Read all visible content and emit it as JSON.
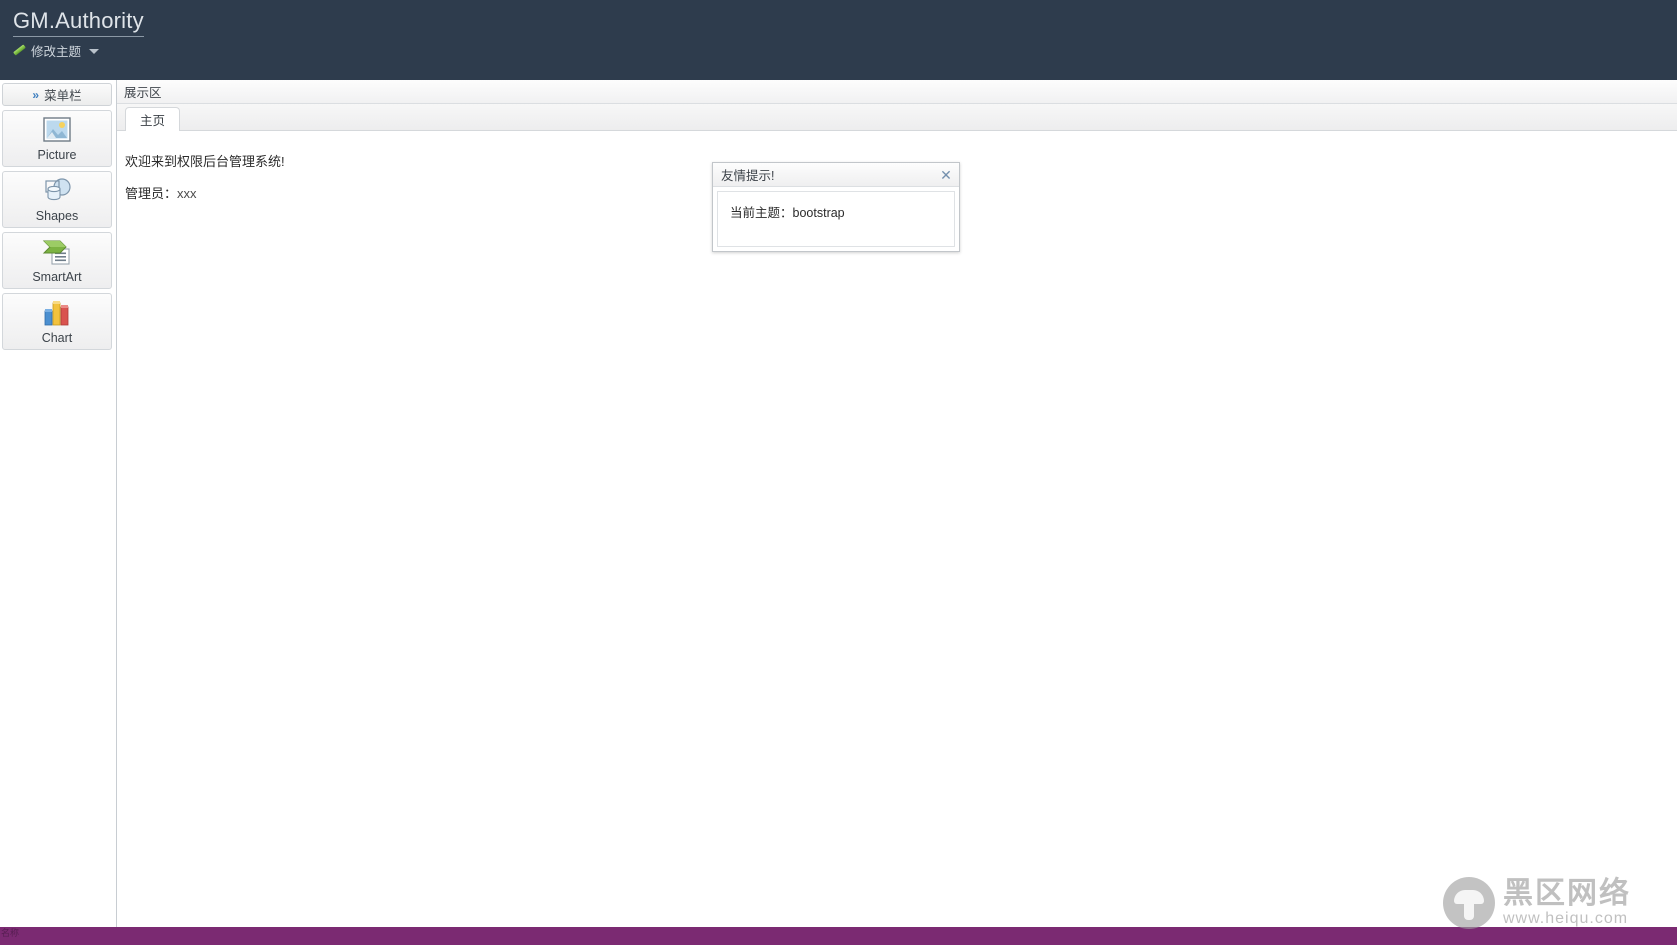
{
  "header": {
    "brand": "GM.Authority",
    "theme_switch": {
      "label": "修改主题",
      "pencil_icon": "pencil-icon",
      "caret_icon": "caret-down-icon"
    }
  },
  "sidebar": {
    "toggle": {
      "label": "菜单栏",
      "icon": "double-chevron-right-icon",
      "chevron": "»"
    },
    "panels": [
      {
        "label": "Picture",
        "icon": "picture-icon"
      },
      {
        "label": "Shapes",
        "icon": "shapes-icon"
      },
      {
        "label": "SmartArt",
        "icon": "smartart-icon"
      },
      {
        "label": "Chart",
        "icon": "chart-icon"
      }
    ]
  },
  "center": {
    "region_title": "展示区",
    "tabs": [
      {
        "label": "主页",
        "active": true
      }
    ],
    "content": {
      "welcome": "欢迎来到权限后台管理系统!",
      "admin_label": "管理员：",
      "admin_value": "xxx"
    }
  },
  "dialog": {
    "title": "友情提示!",
    "close_icon": "close-icon",
    "close_glyph": "✕",
    "message_label": "当前主题：",
    "message_value": "bootstrap"
  },
  "status_bar": {
    "text": "名称"
  },
  "watermark": {
    "cn": "黑区网络",
    "url": "www.heiqu.com",
    "logo_icon": "mushroom-logo-icon"
  },
  "colors": {
    "header_bg": "#2e3c4d",
    "accent_blue": "#3f7fbf",
    "status_bar": "#7b2a72",
    "panel_bg": "#f1f1f2"
  }
}
